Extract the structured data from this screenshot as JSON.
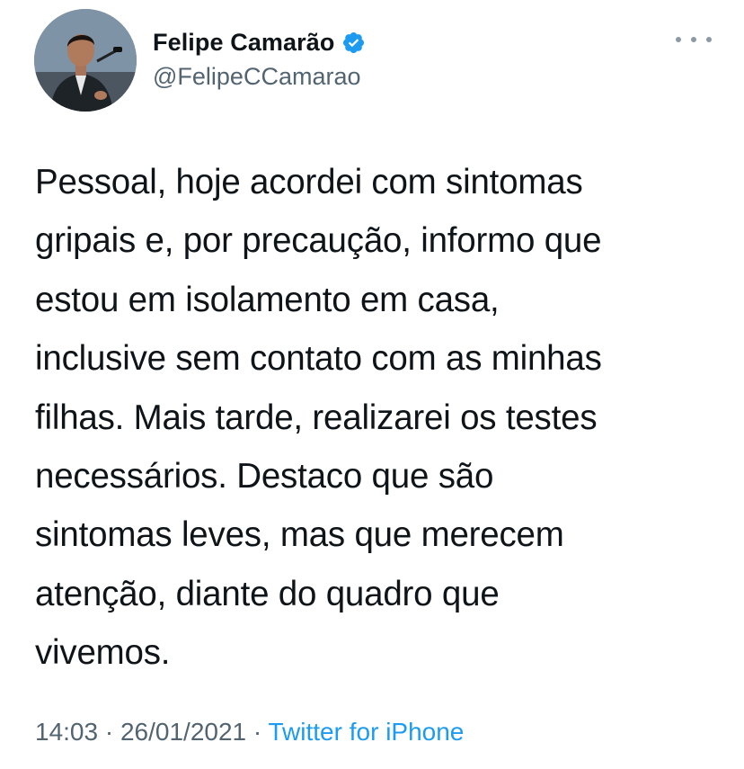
{
  "author": {
    "name": "Felipe Camarão",
    "handle": "@FelipeCCamarao",
    "verified": true,
    "avatar_icon": "profile-photo-speaker-at-podium"
  },
  "menu_icon": "more-horizontal-icon",
  "tweet": {
    "text": "Pessoal, hoje acordei com sintomas\ngripais e, por precaução, informo que\nestou em isolamento em casa,\ninclusive sem contato com as minhas\nfilhas. Mais tarde, realizarei os testes\nnecessários. Destaco que são\nsintomas leves, mas que merecem\natenção, diante do quadro que\nvivemos."
  },
  "meta": {
    "time": "14:03",
    "separator": " · ",
    "date": "26/01/2021",
    "source": "Twitter for iPhone"
  },
  "colors": {
    "verified_badge": "#1d9bf0",
    "link": "#1d9bf0",
    "secondary_text": "#536471",
    "primary_text": "#0f1419"
  }
}
